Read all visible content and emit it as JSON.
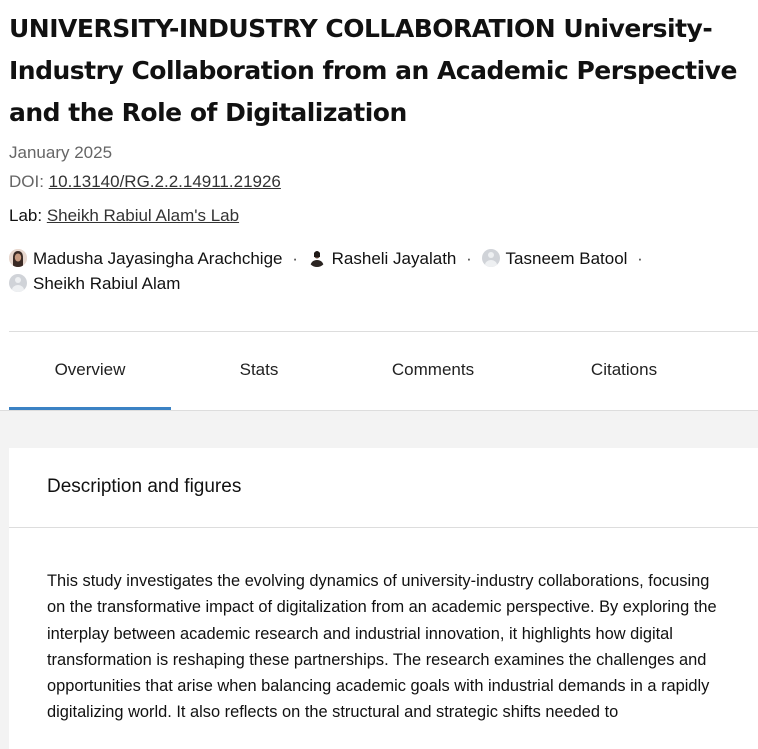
{
  "publication": {
    "title": "UNIVERSITY-INDUSTRY COLLABORATION University-Industry Collaboration from an Academic Perspective and the Role of Digitalization",
    "date": "January 2025",
    "doi_label": "DOI: ",
    "doi": "10.13140/RG.2.2.14911.21926",
    "lab_label": "Lab: ",
    "lab": "Sheikh Rabiul Alam's Lab",
    "separator": "·",
    "authors": [
      {
        "name": "Madusha Jayasingha Arachchige",
        "avatar": "photo-avatar"
      },
      {
        "name": "Rasheli Jayalath",
        "avatar": "photo-avatar"
      },
      {
        "name": "Tasneem Batool",
        "avatar": "placeholder-avatar"
      },
      {
        "name": "Sheikh Rabiul Alam",
        "avatar": "placeholder-avatar"
      }
    ]
  },
  "tabs": [
    {
      "label": "Overview",
      "active": true
    },
    {
      "label": "Stats",
      "active": false
    },
    {
      "label": "Comments",
      "active": false
    },
    {
      "label": "Citations",
      "active": false
    }
  ],
  "section": {
    "title": "Description and figures",
    "body": "This study investigates the evolving dynamics of university-industry collaborations, focusing on the transformative impact of digitalization from an academic perspective. By exploring the interplay between academic research and industrial innovation, it highlights how digital transformation is reshaping these partnerships. The research examines the challenges and opportunities that arise when balancing academic goals with industrial demands in a rapidly digitalizing world. It also reflects on the structural and strategic shifts needed to"
  },
  "colors": {
    "accent": "#3b82c4",
    "page_background": "#f3f3f3",
    "divider": "#dddddd"
  }
}
